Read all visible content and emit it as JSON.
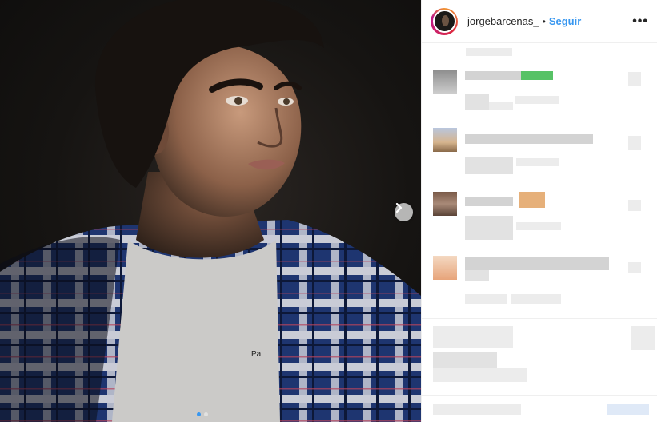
{
  "post": {
    "image_alt": "Retrato de un joven con camisa de cuadros azul",
    "carousel": {
      "count": 2,
      "active": 1
    }
  },
  "header": {
    "username": "jorgebarcenas_",
    "separator": "•",
    "follow_label": "Seguir",
    "more_label": "•••"
  },
  "icons": {
    "next": "chevron-right-icon",
    "more": "ellipsis-icon"
  },
  "colors": {
    "link": "#3897f0",
    "text": "#262626",
    "shirt_blue": "#1f3b7a"
  }
}
